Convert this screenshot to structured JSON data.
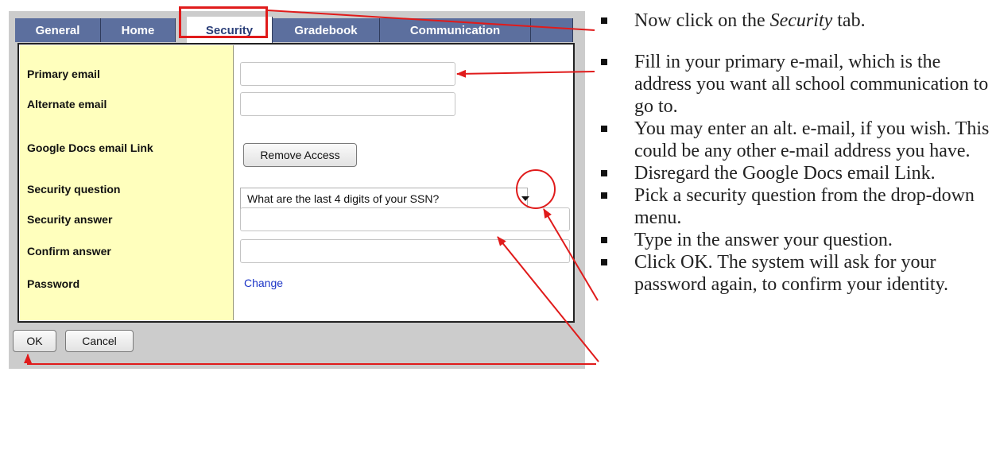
{
  "tabs": [
    {
      "label": "General"
    },
    {
      "label": "Home"
    },
    {
      "label": "Security"
    },
    {
      "label": "Gradebook"
    },
    {
      "label": "Communication"
    }
  ],
  "form": {
    "primary_email_label": "Primary email",
    "primary_email_value": "",
    "alternate_email_label": "Alternate email",
    "alternate_email_value": "",
    "google_docs_label": "Google Docs email Link",
    "remove_access_label": "Remove Access",
    "security_question_label": "Security question",
    "security_question_value": "What are the last 4 digits of your SSN?",
    "security_answer_label": "Security answer",
    "security_answer_value": "",
    "confirm_answer_label": "Confirm answer",
    "confirm_answer_value": "",
    "password_label": "Password",
    "password_link": "Change"
  },
  "footer": {
    "ok_label": "OK",
    "cancel_label": "Cancel"
  },
  "instructions": {
    "step1_before": "Now click on the ",
    "step1_em": "Security",
    "step1_after": " tab.",
    "step2": "Fill in your primary e-mail, which is the address you want all school communication to go to.",
    "step3": "You may enter an alt. e-mail, if you wish. This could be any other e-mail address you have.",
    "step4": "Disregard the Google Docs email Link.",
    "step5": "Pick a security question from the drop-down menu.",
    "step6": "Type in the answer your question.",
    "step7": "Click OK. The system will ask for your password again, to confirm your identity."
  },
  "colors": {
    "annotation": "#e01b1b",
    "tab_bg": "#5c6f9e",
    "label_column": "#ffffbd",
    "link": "#1c35c7"
  }
}
